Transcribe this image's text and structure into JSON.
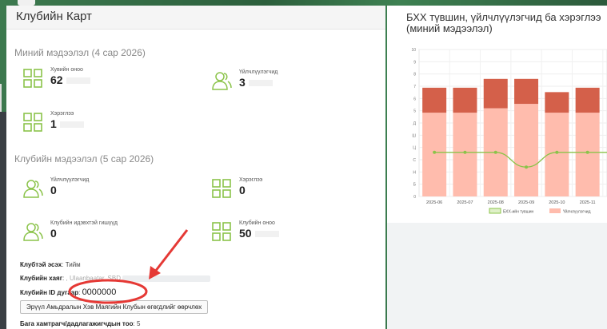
{
  "left_panel": {
    "title": "Клубийн Карт",
    "my_info": {
      "heading": "Миний мэдээлэл (4 сар 2026)",
      "stats": [
        {
          "label": "Хувийн оноо",
          "value": "62",
          "icon": "grid-icon"
        },
        {
          "label": "Үйлчлүүлэгчид",
          "value": "3",
          "icon": "users-icon"
        },
        {
          "label": "Хэрэглээ",
          "value": "1",
          "icon": "grid-icon"
        }
      ]
    },
    "club_info": {
      "heading": "Клубийн мэдээлэл (5 сар 2026)",
      "stats": [
        {
          "label": "Үйлчлүүлэгчид",
          "value": "0",
          "icon": "users-icon"
        },
        {
          "label": "Хэрэглээ",
          "value": "0",
          "icon": "grid-icon"
        },
        {
          "label": "Клубийн идэвхтэй гишүүд",
          "value": "0",
          "icon": "users-icon"
        },
        {
          "label": "Клубийн оноо",
          "value": "50",
          "icon": "grid-icon"
        }
      ]
    },
    "details": {
      "has_club_label": "Клубтэй эсэх",
      "has_club_value": "Тийм",
      "address_label": "Клубийн хаяг",
      "address_value": ", Ulaanbaatar, SBD",
      "id_label": "Клубийн ID дугаар",
      "id_value": "0000000",
      "edit_button": "Эрүүл Амьдралын Хэв Маягийн Клубын өгөгдлийг өөрчлөх",
      "partners_label": "Бага хамтрагч/дадлагажигчдын тоо",
      "partners_value": "5"
    },
    "colors": {
      "icon": "#8bc34a",
      "annotation": "#e53935"
    }
  },
  "right_panel": {
    "title_line1": "БХХ түвшин, үйлчлүүлэгчид ба хэрэглээ",
    "title_line2": "(миний мэдээлэл)"
  },
  "chart_data": {
    "type": "bar",
    "categories": [
      "2025-06",
      "2025-07",
      "2025-08",
      "2025-09",
      "2025-10",
      "2025-11"
    ],
    "y_tick_labels": [
      "0",
      "Б",
      "Н",
      "С",
      "Ц",
      "Ш",
      "Д",
      "5",
      "6",
      "7",
      "8",
      "9",
      "10"
    ],
    "ylim": [
      0,
      10
    ],
    "series": [
      {
        "name": "Үйлчлүүлэгчид",
        "type": "bar",
        "values": [
          5.7,
          5.7,
          6.0,
          6.3,
          5.7,
          5.7
        ],
        "color": "#ffbcad"
      },
      {
        "type": "bar",
        "values": [
          1.7,
          1.7,
          2.0,
          1.7,
          1.4,
          1.7
        ],
        "color": "#d4604a"
      },
      {
        "name": "БХХ-ийн түвшин",
        "type": "line",
        "values": [
          3,
          3,
          3,
          2,
          3,
          3
        ],
        "color": "#8bc34a"
      }
    ],
    "legend_position": "bottom",
    "grid": true
  }
}
